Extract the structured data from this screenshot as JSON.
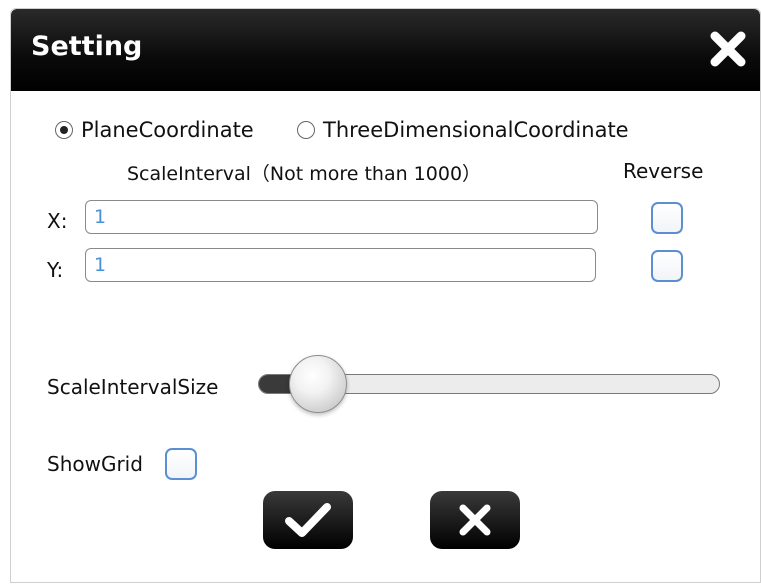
{
  "dialog": {
    "title": "Setting",
    "close_icon": "close-x-icon"
  },
  "coordinate": {
    "options": [
      {
        "label": "PlaneCoordinate",
        "selected": true
      },
      {
        "label": "ThreeDimensionalCoordinate",
        "selected": false
      }
    ]
  },
  "scale_interval": {
    "header": "ScaleInterval（Not more than 1000）",
    "reverse_header": "Reverse",
    "x": {
      "label": "X:",
      "value": "1",
      "reverse_checked": false
    },
    "y": {
      "label": "Y:",
      "value": "1",
      "reverse_checked": false
    }
  },
  "scale_interval_size": {
    "label": "ScaleIntervalSize",
    "level": 0.08
  },
  "show_grid": {
    "label": "ShowGrid",
    "checked": false
  },
  "actions": {
    "confirm_icon": "checkmark-icon",
    "cancel_icon": "close-x-icon"
  },
  "colors": {
    "titlebar": "#000000",
    "checkbox_border": "#5c8fd1",
    "input_text": "#4a90d9",
    "button_bg": "#000000"
  }
}
